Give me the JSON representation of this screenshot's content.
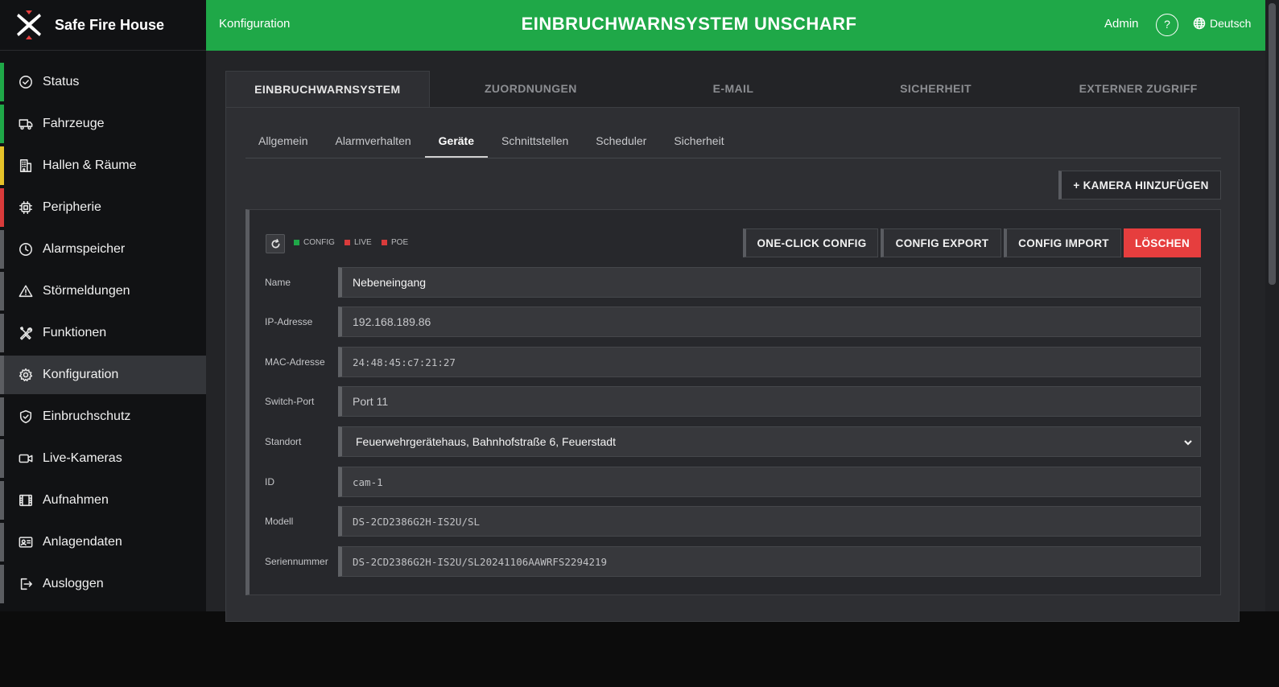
{
  "brand": {
    "name": "Safe Fire House"
  },
  "topbar": {
    "breadcrumb": "Konfiguration",
    "title": "EINBRUCHWARNSYSTEM UNSCHARF",
    "user": "Admin",
    "help": "?",
    "language": "Deutsch",
    "color": "#1fa848"
  },
  "sidebar": {
    "items": [
      {
        "label": "Status",
        "icon": "check-circle-icon",
        "stripe": "#1fa848"
      },
      {
        "label": "Fahrzeuge",
        "icon": "truck-icon",
        "stripe": "#1fa848"
      },
      {
        "label": "Hallen & Räume",
        "icon": "building-icon",
        "stripe": "#e6c229"
      },
      {
        "label": "Peripherie",
        "icon": "chip-icon",
        "stripe": "#d93b3b"
      },
      {
        "label": "Alarmspeicher",
        "icon": "clock-icon",
        "stripe": "#5b5d61"
      },
      {
        "label": "Störmeldungen",
        "icon": "warning-icon",
        "stripe": "#5b5d61"
      },
      {
        "label": "Funktionen",
        "icon": "tools-icon",
        "stripe": "#5b5d61"
      },
      {
        "label": "Konfiguration",
        "icon": "gear-icon",
        "stripe": "#5b5d61",
        "active": true
      },
      {
        "label": "Einbruchschutz",
        "icon": "shield-icon",
        "stripe": "#5b5d61"
      },
      {
        "label": "Live-Kameras",
        "icon": "camera-icon",
        "stripe": "#5b5d61"
      },
      {
        "label": "Aufnahmen",
        "icon": "film-icon",
        "stripe": "#5b5d61"
      },
      {
        "label": "Anlagendaten",
        "icon": "id-card-icon",
        "stripe": "#5b5d61"
      },
      {
        "label": "Ausloggen",
        "icon": "logout-icon",
        "stripe": "#5b5d61"
      }
    ]
  },
  "main_tabs": [
    {
      "label": "EINBRUCHWARNSYSTEM",
      "active": true
    },
    {
      "label": "ZUORDNUNGEN"
    },
    {
      "label": "E-MAIL"
    },
    {
      "label": "SICHERHEIT"
    },
    {
      "label": "EXTERNER ZUGRIFF"
    }
  ],
  "sub_tabs": [
    {
      "label": "Allgemein"
    },
    {
      "label": "Alarmverhalten"
    },
    {
      "label": "Geräte",
      "active": true
    },
    {
      "label": "Schnittstellen"
    },
    {
      "label": "Scheduler"
    },
    {
      "label": "Sicherheit"
    }
  ],
  "add_camera_label": "+ KAMERA HINZUFÜGEN",
  "device": {
    "legend": [
      {
        "label": "CONFIG",
        "color": "#1fa848"
      },
      {
        "label": "LIVE",
        "color": "#d93b3b"
      },
      {
        "label": "POE",
        "color": "#d93b3b"
      }
    ],
    "actions": {
      "one_click": "ONE-CLICK CONFIG",
      "export": "CONFIG EXPORT",
      "import": "CONFIG IMPORT",
      "delete": "LÖSCHEN"
    },
    "fields": {
      "name": {
        "label": "Name",
        "value": "Nebeneingang"
      },
      "ip": {
        "label": "IP-Adresse",
        "value": "192.168.189.86"
      },
      "mac": {
        "label": "MAC-Adresse",
        "value": "24:48:45:c7:21:27"
      },
      "port": {
        "label": "Switch-Port",
        "value": "Port 11"
      },
      "location": {
        "label": "Standort",
        "value": "Feuerwehrgerätehaus, Bahnhofstraße 6, Feuerstadt"
      },
      "id": {
        "label": "ID",
        "value": "cam-1"
      },
      "model": {
        "label": "Modell",
        "value": "DS-2CD2386G2H-IS2U/SL"
      },
      "serial": {
        "label": "Seriennummer",
        "value": "DS-2CD2386G2H-IS2U/SL20241106AAWRFS2294219"
      }
    }
  }
}
